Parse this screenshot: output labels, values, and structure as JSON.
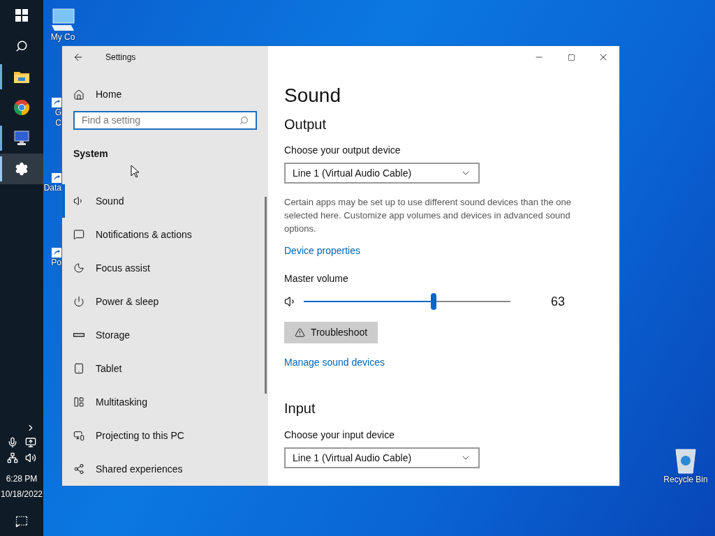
{
  "taskbar": {
    "apps": [
      {
        "kind": "start",
        "running": false,
        "selected": false
      },
      {
        "kind": "search",
        "running": false,
        "selected": false
      },
      {
        "kind": "explorer",
        "running": true,
        "selected": false
      },
      {
        "kind": "chrome",
        "running": false,
        "selected": false
      },
      {
        "kind": "monitor",
        "running": true,
        "selected": false
      },
      {
        "kind": "settings",
        "running": true,
        "selected": true
      }
    ],
    "tray": {
      "time": "6:28 PM",
      "date": "10/18/2022"
    }
  },
  "desktop_icons": [
    {
      "kind": "computer",
      "lines": [
        "My Co"
      ]
    },
    {
      "kind": "chrome",
      "lines": [
        "G",
        "C"
      ]
    },
    {
      "kind": "data",
      "lines": [
        "Data"
      ]
    },
    {
      "kind": "po",
      "lines": [
        "Po"
      ]
    },
    {
      "kind": "recycle",
      "lines": [
        "Recycle Bin"
      ]
    }
  ],
  "window": {
    "title": "Settings",
    "sidebar": {
      "home": "Home",
      "search": {
        "placeholder": "Find a setting"
      },
      "section": "System",
      "items": [
        {
          "kind": "sound",
          "label": "Sound",
          "selected": true
        },
        {
          "kind": "notifications",
          "label": "Notifications & actions",
          "selected": false
        },
        {
          "kind": "focus",
          "label": "Focus assist",
          "selected": false
        },
        {
          "kind": "power",
          "label": "Power & sleep",
          "selected": false
        },
        {
          "kind": "storage",
          "label": "Storage",
          "selected": false
        },
        {
          "kind": "tablet",
          "label": "Tablet",
          "selected": false
        },
        {
          "kind": "multitasking",
          "label": "Multitasking",
          "selected": false
        },
        {
          "kind": "projecting",
          "label": "Projecting to this PC",
          "selected": false
        },
        {
          "kind": "shared",
          "label": "Shared experiences",
          "selected": false
        }
      ]
    },
    "content": {
      "title": "Sound",
      "output": {
        "heading": "Output",
        "device_label": "Choose your output device",
        "device": "Line 1 (Virtual Audio Cable)",
        "note": "Certain apps may be set up to use different sound devices than the one selected here. Customize app volumes and devices in advanced sound options.",
        "properties_link": "Device properties",
        "volume_label": "Master volume",
        "volume": {
          "level": 0.63,
          "reading": "63"
        },
        "troubleshoot": "Troubleshoot",
        "manage_link": "Manage sound devices"
      },
      "input": {
        "heading": "Input",
        "device_label": "Choose your input device",
        "device": "Line 1 (Virtual Audio Cable)"
      }
    }
  }
}
